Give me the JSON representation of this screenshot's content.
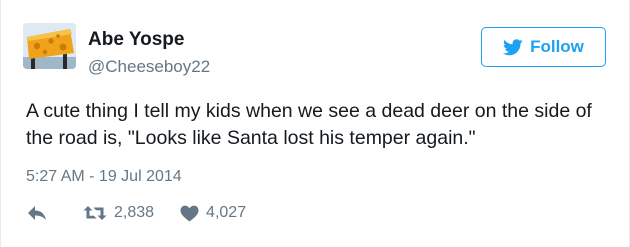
{
  "author": {
    "display_name": "Abe Yospe",
    "handle": "@Cheeseboy22",
    "avatar_icon": "cheese-avatar"
  },
  "follow_button": {
    "label": "Follow",
    "icon": "twitter-bird-icon",
    "color": "#1da1f2"
  },
  "tweet": {
    "text": "A cute thing I tell my kids when we see a dead deer on the side of the road is, \"Looks like Santa lost his temper again.\"",
    "timestamp": "5:27 AM - 19 Jul 2014"
  },
  "actions": {
    "reply_icon": "reply-icon",
    "retweet_icon": "retweet-icon",
    "retweet_count": "2,838",
    "like_icon": "heart-icon",
    "like_count": "4,027"
  }
}
